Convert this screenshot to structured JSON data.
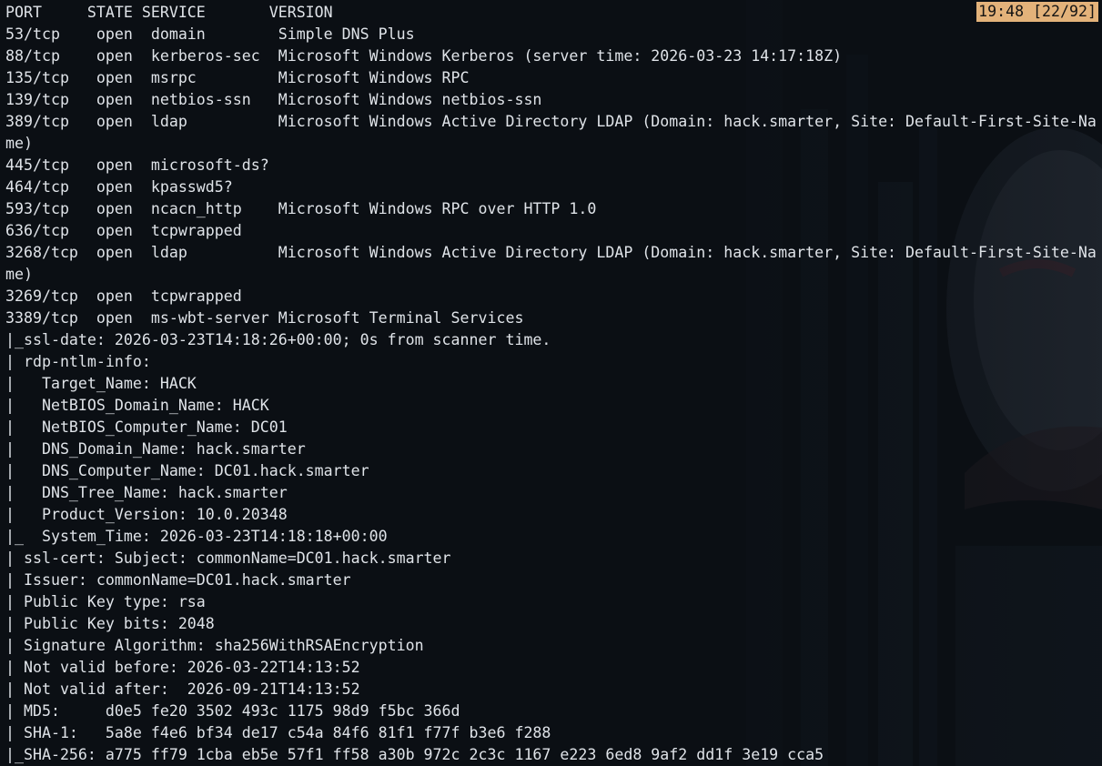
{
  "terminal": {
    "status_bar": "19:48 [22/92]",
    "accent_color": "#e3b27a",
    "lines": [
      "PORT     STATE SERVICE       VERSION",
      "53/tcp    open  domain        Simple DNS Plus",
      "88/tcp    open  kerberos-sec  Microsoft Windows Kerberos (server time: 2026-03-23 14:17:18Z)",
      "135/tcp   open  msrpc         Microsoft Windows RPC",
      "139/tcp   open  netbios-ssn   Microsoft Windows netbios-ssn",
      "389/tcp   open  ldap          Microsoft Windows Active Directory LDAP (Domain: hack.smarter, Site: Default-First-Site-Na",
      "me)",
      "445/tcp   open  microsoft-ds?",
      "464/tcp   open  kpasswd5?",
      "593/tcp   open  ncacn_http    Microsoft Windows RPC over HTTP 1.0",
      "636/tcp   open  tcpwrapped",
      "3268/tcp  open  ldap          Microsoft Windows Active Directory LDAP (Domain: hack.smarter, Site: Default-First-Site-Na",
      "me)",
      "3269/tcp  open  tcpwrapped",
      "3389/tcp  open  ms-wbt-server Microsoft Terminal Services",
      "|_ssl-date: 2026-03-23T14:18:26+00:00; 0s from scanner time.",
      "| rdp-ntlm-info:",
      "|   Target_Name: HACK",
      "|   NetBIOS_Domain_Name: HACK",
      "|   NetBIOS_Computer_Name: DC01",
      "|   DNS_Domain_Name: hack.smarter",
      "|   DNS_Computer_Name: DC01.hack.smarter",
      "|   DNS_Tree_Name: hack.smarter",
      "|   Product_Version: 10.0.20348",
      "|_  System_Time: 2026-03-23T14:18:18+00:00",
      "| ssl-cert: Subject: commonName=DC01.hack.smarter",
      "| Issuer: commonName=DC01.hack.smarter",
      "| Public Key type: rsa",
      "| Public Key bits: 2048",
      "| Signature Algorithm: sha256WithRSAEncryption",
      "| Not valid before: 2026-03-22T14:13:52",
      "| Not valid after:  2026-09-21T14:13:52",
      "| MD5:     d0e5 fe20 3502 493c 1175 98d9 f5bc 366d",
      "| SHA-1:   5a8e f4e6 bf34 de17 c54a 84f6 81f1 f77f b3e6 f288",
      "|_SHA-256: a775 ff79 1cba eb5e 57f1 ff58 a30b 972c 2c3c 1167 e223 6ed8 9af2 dd1f 3e19 cca5"
    ]
  }
}
